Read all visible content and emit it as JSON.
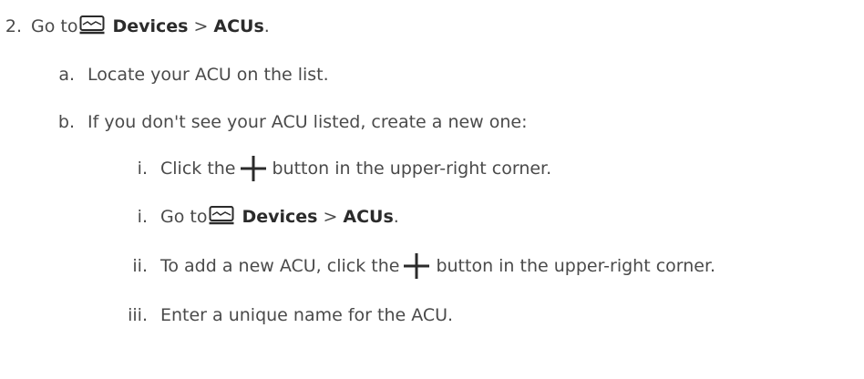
{
  "steps": {
    "s2": {
      "num": "2.",
      "pre": "Go to",
      "bold1": "Devices",
      "sep": ">",
      "bold2": "ACUs",
      "post": "."
    },
    "a": {
      "num": "a.",
      "text": "Locate your ACU on the list."
    },
    "b": {
      "num": "b.",
      "text": "If you don't see your ACU listed, create a new one:"
    },
    "i1": {
      "num": "i.",
      "pre": "Click the",
      "post": "button in the upper-right corner."
    },
    "i2": {
      "num": "i.",
      "pre": "Go to",
      "bold1": "Devices",
      "sep": ">",
      "bold2": "ACUs",
      "post": "."
    },
    "ii": {
      "num": "ii.",
      "pre": "To add a new ACU, click the",
      "post": "button in the upper-right corner."
    },
    "iii": {
      "num": "iii.",
      "text": "Enter a unique name for the ACU."
    }
  },
  "icons": {
    "device": "device-icon",
    "plus": "plus-icon"
  }
}
